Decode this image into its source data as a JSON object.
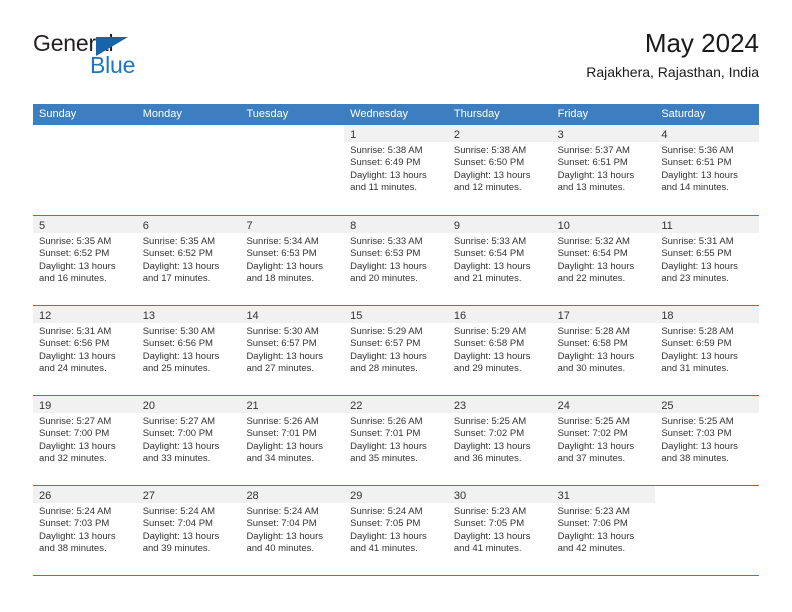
{
  "brand": {
    "name_part1": "General",
    "name_part2": "Blue",
    "accent_color": "#1f76bd",
    "triangle_color": "#1565a8"
  },
  "header": {
    "title": "May 2024",
    "subtitle": "Rajakhera, Rajasthan, India"
  },
  "calendar": {
    "header_bg": "#3d7ec0",
    "daynum_bg": "#f1f1f1",
    "weekdays": [
      "Sunday",
      "Monday",
      "Tuesday",
      "Wednesday",
      "Thursday",
      "Friday",
      "Saturday"
    ],
    "weeks": [
      [
        {
          "day": "",
          "sunrise": "",
          "sunset": "",
          "daylight1": "",
          "daylight2": ""
        },
        {
          "day": "",
          "sunrise": "",
          "sunset": "",
          "daylight1": "",
          "daylight2": ""
        },
        {
          "day": "",
          "sunrise": "",
          "sunset": "",
          "daylight1": "",
          "daylight2": ""
        },
        {
          "day": "1",
          "sunrise": "Sunrise: 5:38 AM",
          "sunset": "Sunset: 6:49 PM",
          "daylight1": "Daylight: 13 hours",
          "daylight2": "and 11 minutes."
        },
        {
          "day": "2",
          "sunrise": "Sunrise: 5:38 AM",
          "sunset": "Sunset: 6:50 PM",
          "daylight1": "Daylight: 13 hours",
          "daylight2": "and 12 minutes."
        },
        {
          "day": "3",
          "sunrise": "Sunrise: 5:37 AM",
          "sunset": "Sunset: 6:51 PM",
          "daylight1": "Daylight: 13 hours",
          "daylight2": "and 13 minutes."
        },
        {
          "day": "4",
          "sunrise": "Sunrise: 5:36 AM",
          "sunset": "Sunset: 6:51 PM",
          "daylight1": "Daylight: 13 hours",
          "daylight2": "and 14 minutes."
        }
      ],
      [
        {
          "day": "5",
          "sunrise": "Sunrise: 5:35 AM",
          "sunset": "Sunset: 6:52 PM",
          "daylight1": "Daylight: 13 hours",
          "daylight2": "and 16 minutes."
        },
        {
          "day": "6",
          "sunrise": "Sunrise: 5:35 AM",
          "sunset": "Sunset: 6:52 PM",
          "daylight1": "Daylight: 13 hours",
          "daylight2": "and 17 minutes."
        },
        {
          "day": "7",
          "sunrise": "Sunrise: 5:34 AM",
          "sunset": "Sunset: 6:53 PM",
          "daylight1": "Daylight: 13 hours",
          "daylight2": "and 18 minutes."
        },
        {
          "day": "8",
          "sunrise": "Sunrise: 5:33 AM",
          "sunset": "Sunset: 6:53 PM",
          "daylight1": "Daylight: 13 hours",
          "daylight2": "and 20 minutes."
        },
        {
          "day": "9",
          "sunrise": "Sunrise: 5:33 AM",
          "sunset": "Sunset: 6:54 PM",
          "daylight1": "Daylight: 13 hours",
          "daylight2": "and 21 minutes."
        },
        {
          "day": "10",
          "sunrise": "Sunrise: 5:32 AM",
          "sunset": "Sunset: 6:54 PM",
          "daylight1": "Daylight: 13 hours",
          "daylight2": "and 22 minutes."
        },
        {
          "day": "11",
          "sunrise": "Sunrise: 5:31 AM",
          "sunset": "Sunset: 6:55 PM",
          "daylight1": "Daylight: 13 hours",
          "daylight2": "and 23 minutes."
        }
      ],
      [
        {
          "day": "12",
          "sunrise": "Sunrise: 5:31 AM",
          "sunset": "Sunset: 6:56 PM",
          "daylight1": "Daylight: 13 hours",
          "daylight2": "and 24 minutes."
        },
        {
          "day": "13",
          "sunrise": "Sunrise: 5:30 AM",
          "sunset": "Sunset: 6:56 PM",
          "daylight1": "Daylight: 13 hours",
          "daylight2": "and 25 minutes."
        },
        {
          "day": "14",
          "sunrise": "Sunrise: 5:30 AM",
          "sunset": "Sunset: 6:57 PM",
          "daylight1": "Daylight: 13 hours",
          "daylight2": "and 27 minutes."
        },
        {
          "day": "15",
          "sunrise": "Sunrise: 5:29 AM",
          "sunset": "Sunset: 6:57 PM",
          "daylight1": "Daylight: 13 hours",
          "daylight2": "and 28 minutes."
        },
        {
          "day": "16",
          "sunrise": "Sunrise: 5:29 AM",
          "sunset": "Sunset: 6:58 PM",
          "daylight1": "Daylight: 13 hours",
          "daylight2": "and 29 minutes."
        },
        {
          "day": "17",
          "sunrise": "Sunrise: 5:28 AM",
          "sunset": "Sunset: 6:58 PM",
          "daylight1": "Daylight: 13 hours",
          "daylight2": "and 30 minutes."
        },
        {
          "day": "18",
          "sunrise": "Sunrise: 5:28 AM",
          "sunset": "Sunset: 6:59 PM",
          "daylight1": "Daylight: 13 hours",
          "daylight2": "and 31 minutes."
        }
      ],
      [
        {
          "day": "19",
          "sunrise": "Sunrise: 5:27 AM",
          "sunset": "Sunset: 7:00 PM",
          "daylight1": "Daylight: 13 hours",
          "daylight2": "and 32 minutes."
        },
        {
          "day": "20",
          "sunrise": "Sunrise: 5:27 AM",
          "sunset": "Sunset: 7:00 PM",
          "daylight1": "Daylight: 13 hours",
          "daylight2": "and 33 minutes."
        },
        {
          "day": "21",
          "sunrise": "Sunrise: 5:26 AM",
          "sunset": "Sunset: 7:01 PM",
          "daylight1": "Daylight: 13 hours",
          "daylight2": "and 34 minutes."
        },
        {
          "day": "22",
          "sunrise": "Sunrise: 5:26 AM",
          "sunset": "Sunset: 7:01 PM",
          "daylight1": "Daylight: 13 hours",
          "daylight2": "and 35 minutes."
        },
        {
          "day": "23",
          "sunrise": "Sunrise: 5:25 AM",
          "sunset": "Sunset: 7:02 PM",
          "daylight1": "Daylight: 13 hours",
          "daylight2": "and 36 minutes."
        },
        {
          "day": "24",
          "sunrise": "Sunrise: 5:25 AM",
          "sunset": "Sunset: 7:02 PM",
          "daylight1": "Daylight: 13 hours",
          "daylight2": "and 37 minutes."
        },
        {
          "day": "25",
          "sunrise": "Sunrise: 5:25 AM",
          "sunset": "Sunset: 7:03 PM",
          "daylight1": "Daylight: 13 hours",
          "daylight2": "and 38 minutes."
        }
      ],
      [
        {
          "day": "26",
          "sunrise": "Sunrise: 5:24 AM",
          "sunset": "Sunset: 7:03 PM",
          "daylight1": "Daylight: 13 hours",
          "daylight2": "and 38 minutes."
        },
        {
          "day": "27",
          "sunrise": "Sunrise: 5:24 AM",
          "sunset": "Sunset: 7:04 PM",
          "daylight1": "Daylight: 13 hours",
          "daylight2": "and 39 minutes."
        },
        {
          "day": "28",
          "sunrise": "Sunrise: 5:24 AM",
          "sunset": "Sunset: 7:04 PM",
          "daylight1": "Daylight: 13 hours",
          "daylight2": "and 40 minutes."
        },
        {
          "day": "29",
          "sunrise": "Sunrise: 5:24 AM",
          "sunset": "Sunset: 7:05 PM",
          "daylight1": "Daylight: 13 hours",
          "daylight2": "and 41 minutes."
        },
        {
          "day": "30",
          "sunrise": "Sunrise: 5:23 AM",
          "sunset": "Sunset: 7:05 PM",
          "daylight1": "Daylight: 13 hours",
          "daylight2": "and 41 minutes."
        },
        {
          "day": "31",
          "sunrise": "Sunrise: 5:23 AM",
          "sunset": "Sunset: 7:06 PM",
          "daylight1": "Daylight: 13 hours",
          "daylight2": "and 42 minutes."
        },
        {
          "day": "",
          "sunrise": "",
          "sunset": "",
          "daylight1": "",
          "daylight2": ""
        }
      ]
    ]
  }
}
